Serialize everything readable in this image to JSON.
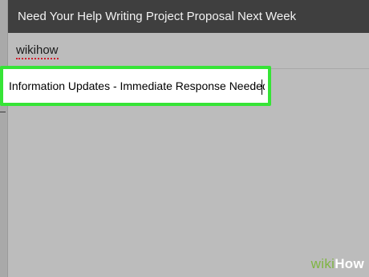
{
  "window": {
    "title": "Need Your Help Writing Project Proposal Next Week"
  },
  "compose": {
    "to_value": "wikihow",
    "subject_value": "Information Updates - Immediate Response Needed"
  },
  "watermark": {
    "wiki": "wiki",
    "how": "How"
  },
  "colors": {
    "title_bar": "#3f3f3f",
    "highlight": "#36e436",
    "background": "#bcbcbc",
    "spellcheck_underline": "#d11a2a"
  }
}
